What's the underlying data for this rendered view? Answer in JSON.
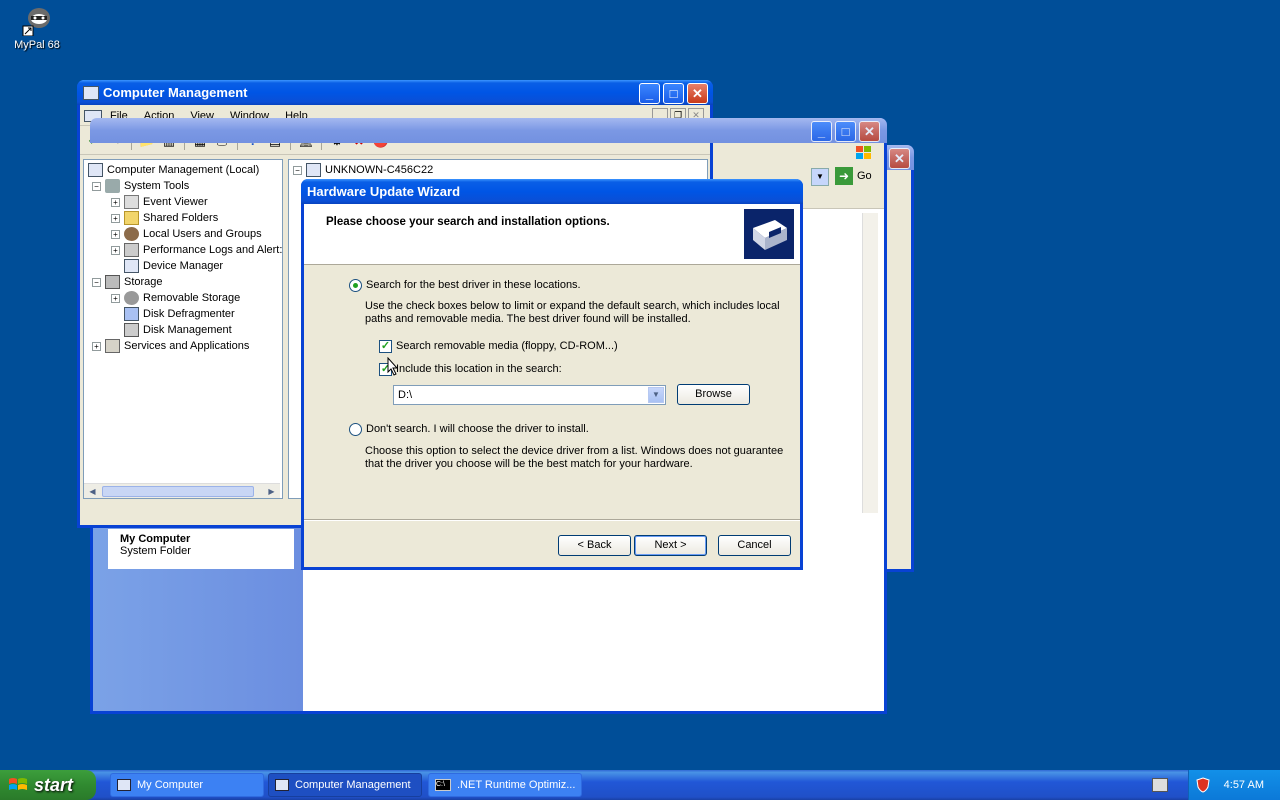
{
  "desktop": {
    "icon_label": "MyPal 68"
  },
  "my_computer_window": {
    "card_title": "My Computer",
    "card_subtitle": "System Folder",
    "go_label": "Go"
  },
  "comp_mgmt": {
    "title": "Computer Management",
    "menu": [
      "File",
      "Action",
      "View",
      "Window",
      "Help"
    ],
    "tree": {
      "root": "Computer Management (Local)",
      "system_tools": "System Tools",
      "event_viewer": "Event Viewer",
      "shared_folders": "Shared Folders",
      "local_users": "Local Users and Groups",
      "perf_logs": "Performance Logs and Alert:",
      "device_manager": "Device Manager",
      "storage": "Storage",
      "removable_storage": "Removable Storage",
      "disk_defrag": "Disk Defragmenter",
      "disk_mgmt": "Disk Management",
      "services": "Services and Applications"
    },
    "right_root": "UNKNOWN-C456C22"
  },
  "wizard": {
    "title": "Hardware Update Wizard",
    "header": "Please choose your search and installation options.",
    "opt1_label": "Search for the best driver in these locations.",
    "opt1_desc": "Use the check boxes below to limit or expand the default search, which includes local paths and removable media. The best driver found will be installed.",
    "chk1_label": "Search removable media (floppy, CD-ROM...)",
    "chk2_label": "Include this location in the search:",
    "location_value": "D:\\",
    "browse": "Browse",
    "opt2_label": "Don't search. I will choose the driver to install.",
    "opt2_desc": "Choose this option to select the device driver from a list.  Windows does not guarantee that the driver you choose will be the best match for your hardware.",
    "back": "< Back",
    "next": "Next >",
    "cancel": "Cancel"
  },
  "taskbar": {
    "start": "start",
    "tasks": [
      "My Computer",
      "Computer Management",
      ".NET Runtime Optimiz..."
    ],
    "clock": "4:57 AM"
  }
}
